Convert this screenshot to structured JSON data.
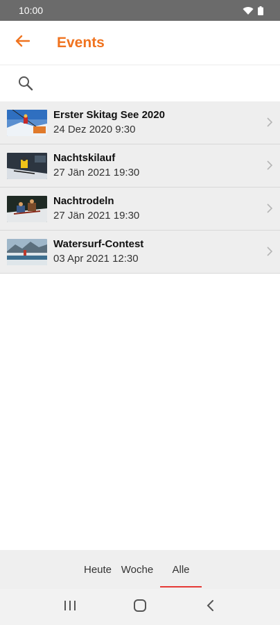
{
  "status_bar": {
    "time": "10:00",
    "icons": [
      "wifi-icon",
      "battery-icon"
    ]
  },
  "app_bar": {
    "back_icon": "arrow-left-icon",
    "title": "Events"
  },
  "search": {
    "icon": "search-icon",
    "value": ""
  },
  "events": [
    {
      "title": "Erster Skitag See 2020",
      "date": "24 Dez 2020 9:30",
      "image": "skier-lift-image"
    },
    {
      "title": "Nachtskilauf",
      "date": "27 Jän 2021 19:30",
      "image": "night-skier-image"
    },
    {
      "title": "Nachtrodeln",
      "date": "27 Jän 2021 19:30",
      "image": "sled-image"
    },
    {
      "title": "Watersurf-Contest",
      "date": "03 Apr 2021 12:30",
      "image": "watersurf-image"
    }
  ],
  "tabs": [
    {
      "label": "Heute",
      "active": false
    },
    {
      "label": "Woche",
      "active": false
    },
    {
      "label": "Alle",
      "active": true
    }
  ],
  "nav_bar": {
    "icons": [
      "recent-apps-icon",
      "home-icon",
      "back-icon"
    ]
  },
  "colors": {
    "accent": "#f0731f",
    "tab_indicator": "#e53935",
    "status_bar": "#6b6b6b",
    "row_background": "#eeeeee"
  }
}
